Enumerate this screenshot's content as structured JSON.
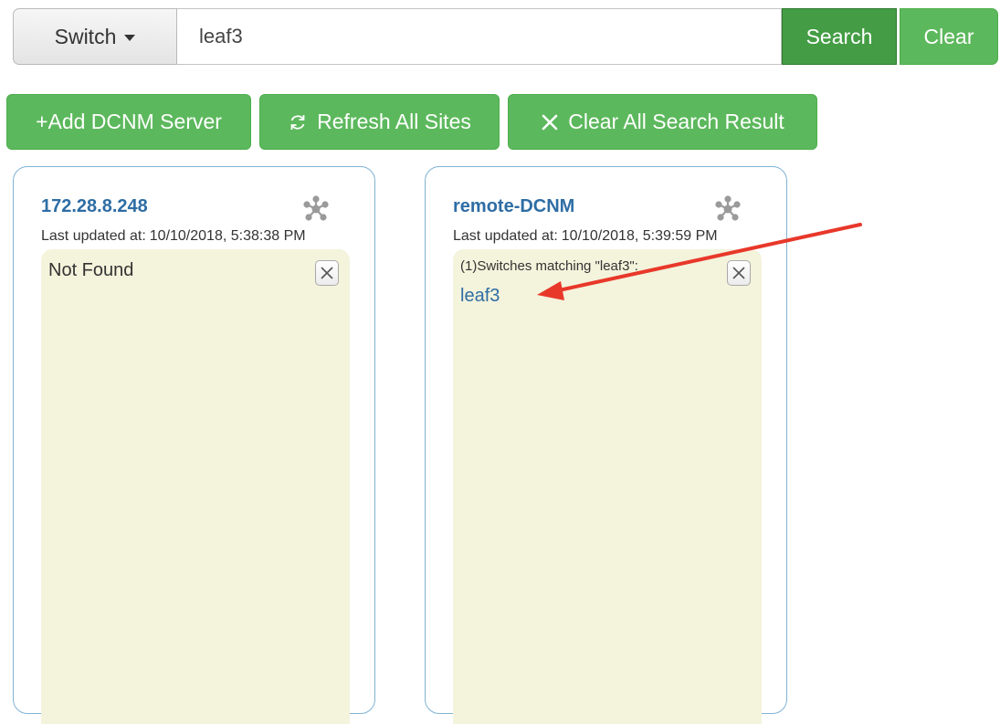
{
  "search": {
    "type_label": "Switch",
    "query": "leaf3",
    "search_label": "Search",
    "clear_label": "Clear"
  },
  "actions": {
    "add_server": "+Add DCNM Server",
    "refresh_all": "Refresh All Sites",
    "clear_results": "Clear All Search Result"
  },
  "sites": [
    {
      "name": "172.28.8.248",
      "updated_label": "Last updated at:",
      "updated_at": "10/10/2018, 5:38:38 PM",
      "result_message": "Not Found"
    },
    {
      "name": "remote-DCNM",
      "updated_label": "Last updated at:",
      "updated_at": "10/10/2018, 5:39:59 PM",
      "result_heading": "(1)Switches matching \"leaf3\":",
      "results": [
        "leaf3"
      ]
    }
  ],
  "colors": {
    "primary_green": "#5cb85c",
    "active_green": "#449d44",
    "link_blue": "#2e6da4",
    "panel_bg": "#f4f3dc",
    "annotation_red": "#e8382a"
  },
  "icons": {
    "dropdown": "caret-down-icon",
    "refresh": "refresh-icon",
    "clear": "x-icon",
    "topology": "topology-icon",
    "close": "close-icon"
  }
}
